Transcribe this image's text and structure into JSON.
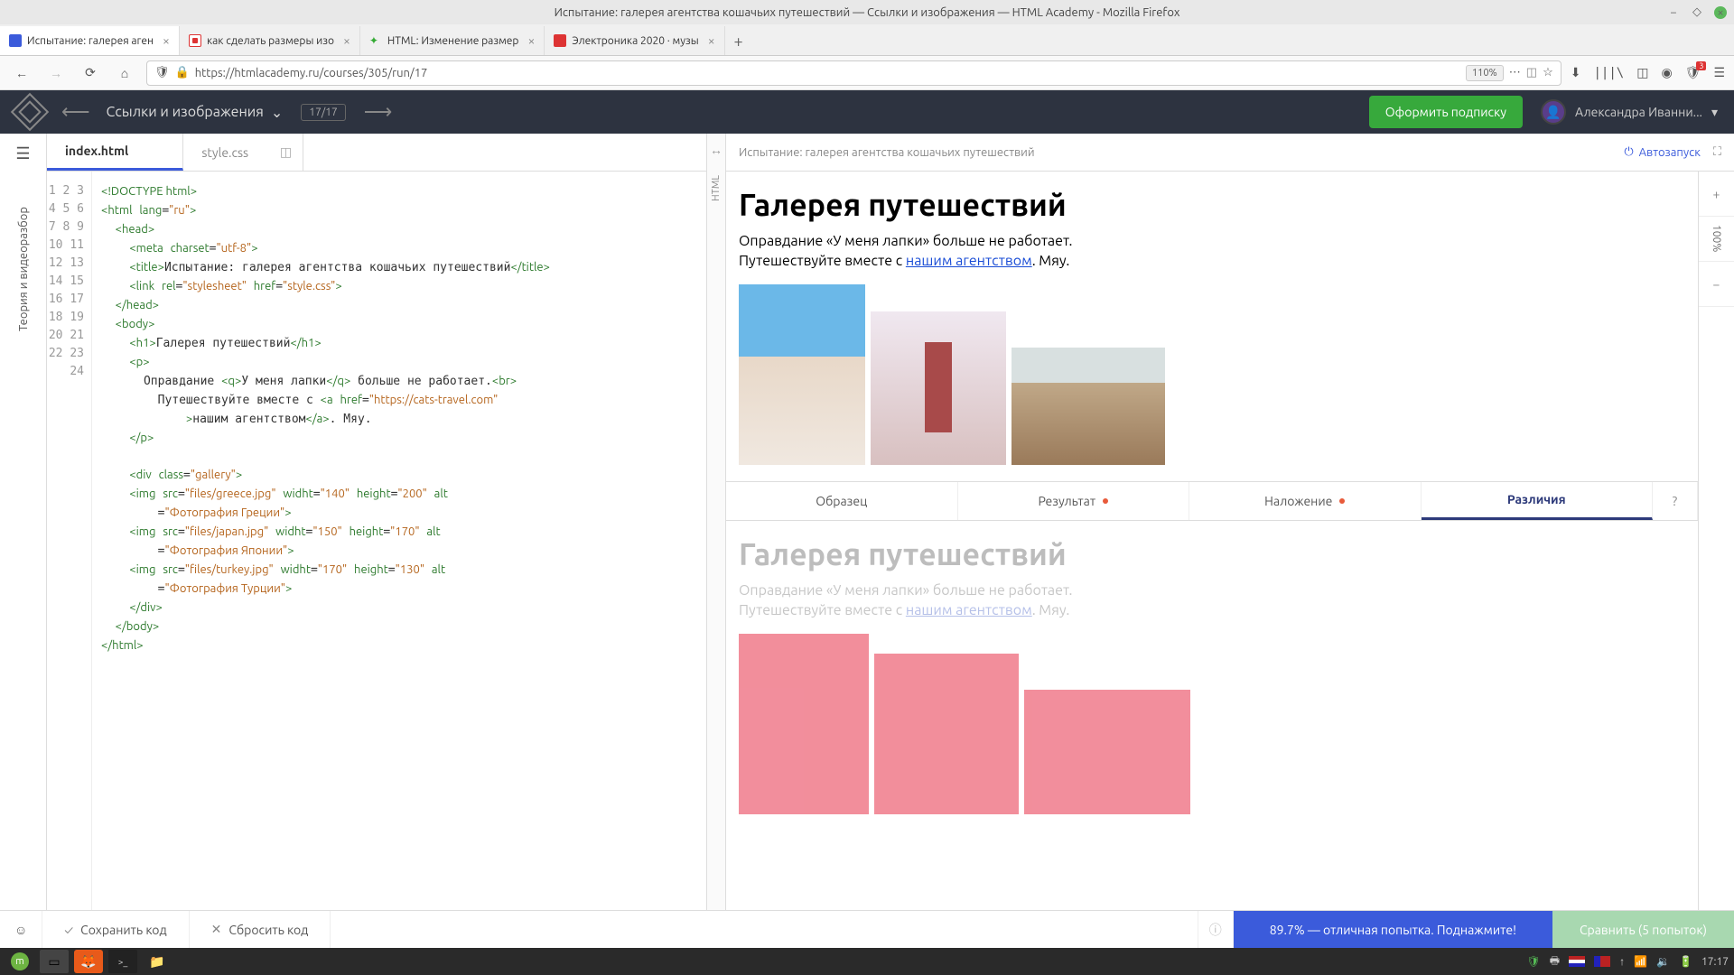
{
  "window": {
    "title": "Испытание: галерея агентства кошачьих путешествий — Ссылки и изображения — HTML Academy - Mozilla Firefox"
  },
  "browser_tabs": [
    {
      "label": "Испытание: галерея аген",
      "active": true,
      "icon": "#3b5bdb"
    },
    {
      "label": "как сделать размеры изо",
      "active": false,
      "icon": "#d33"
    },
    {
      "label": "HTML: Изменение размер",
      "active": false,
      "icon": "#3a3"
    },
    {
      "label": "Электроника 2020 · музы",
      "active": false,
      "icon": "#d33"
    }
  ],
  "url": "https://htmlacademy.ru/courses/305/run/17",
  "zoom": "110%",
  "cart_count": "3",
  "app_header": {
    "course": "Ссылки и изображения",
    "progress": "17/17",
    "subscribe": "Оформить подписку",
    "user": "Александра Иванни..."
  },
  "left_rail": "Теория и видеоразбор",
  "file_tabs": [
    {
      "name": "index.html",
      "active": true
    },
    {
      "name": "style.css",
      "active": false
    }
  ],
  "code_lines": [
    "1",
    "2",
    "3",
    "4",
    "5",
    "6",
    "7",
    "8",
    "9",
    "10",
    "11",
    "12",
    "13",
    "14",
    "15",
    "16",
    "17",
    "18",
    "19",
    "20",
    "21",
    "22",
    "23",
    "24"
  ],
  "preview": {
    "title": "Испытание: галерея агентства кошачьих путешествий",
    "autorun": "Автозапуск",
    "side_percent": "100%",
    "plus": "+",
    "minus": "−"
  },
  "result": {
    "h1": "Галерея путешествий",
    "p1a": "Оправдание «У меня лапки» больше не работает.",
    "p1b": "Путешествуйте вместе с ",
    "link": "нашим агентством",
    "p1c": ". Мяу."
  },
  "result_tabs": {
    "sample": "Образец",
    "result": "Результат",
    "overlay": "Наложение",
    "diff": "Различия"
  },
  "footer": {
    "save": "Сохранить код",
    "reset": "Сбросить код",
    "score": "89.7% — отличная попытка. Поднажмите!",
    "compare": "Сравнить (5 попыток)"
  },
  "taskbar": {
    "time": "17:17"
  }
}
